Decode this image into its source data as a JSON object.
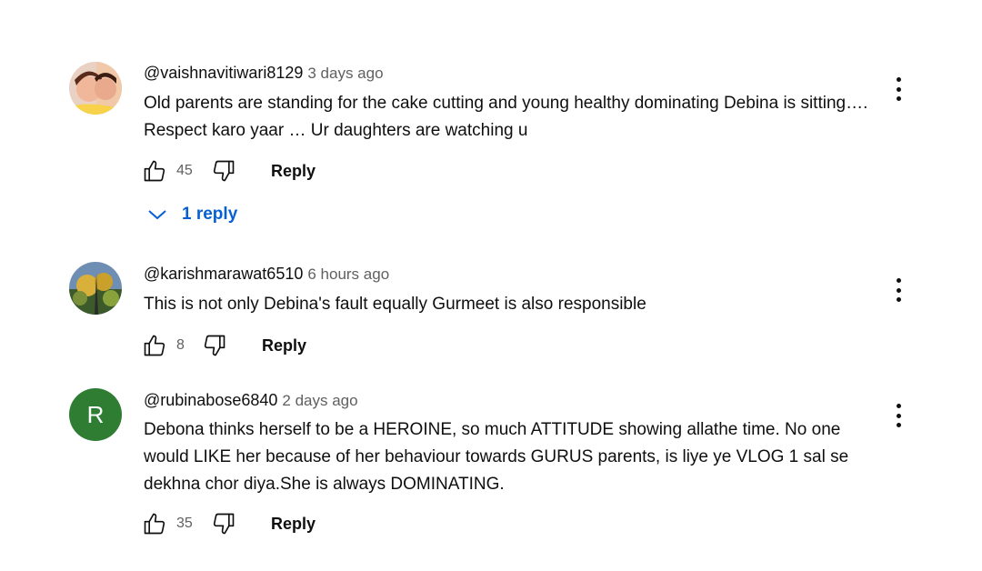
{
  "comments": [
    {
      "handle": "@vaishnavitiwari8129",
      "time": "3 days ago",
      "text": "Old parents are standing for the cake cutting and young healthy dominating Debina is sitting…. Respect karo yaar … Ur daughters are watching u",
      "likes": "45",
      "reply_label": "Reply",
      "replies_label": "1 reply",
      "avatar": "photo-avatar"
    },
    {
      "handle": "@karishmarawat6510",
      "time": "6 hours ago",
      "text": "This is not only Debina's fault equally Gurmeet is also responsible",
      "likes": "8",
      "reply_label": "Reply",
      "avatar": "photo-avatar"
    },
    {
      "handle": "@rubinabose6840",
      "time": "2 days ago",
      "text": "Debona thinks herself to be a HEROINE, so much ATTITUDE showing allathe time. No one would LIKE her because of her behaviour towards GURUS parents, is liye ye VLOG 1 sal se dekhna chor diya.She is always DOMINATING.",
      "likes": "35",
      "reply_label": "Reply",
      "avatar_letter": "R",
      "avatar_color": "#2e7d32"
    }
  ],
  "colors": {
    "link": "#065fd4",
    "secondary_text": "#606060",
    "primary_text": "#0f0f0f"
  },
  "icons": [
    "thumbs-up-icon",
    "thumbs-down-icon",
    "more-vert-icon",
    "chevron-down-icon"
  ]
}
